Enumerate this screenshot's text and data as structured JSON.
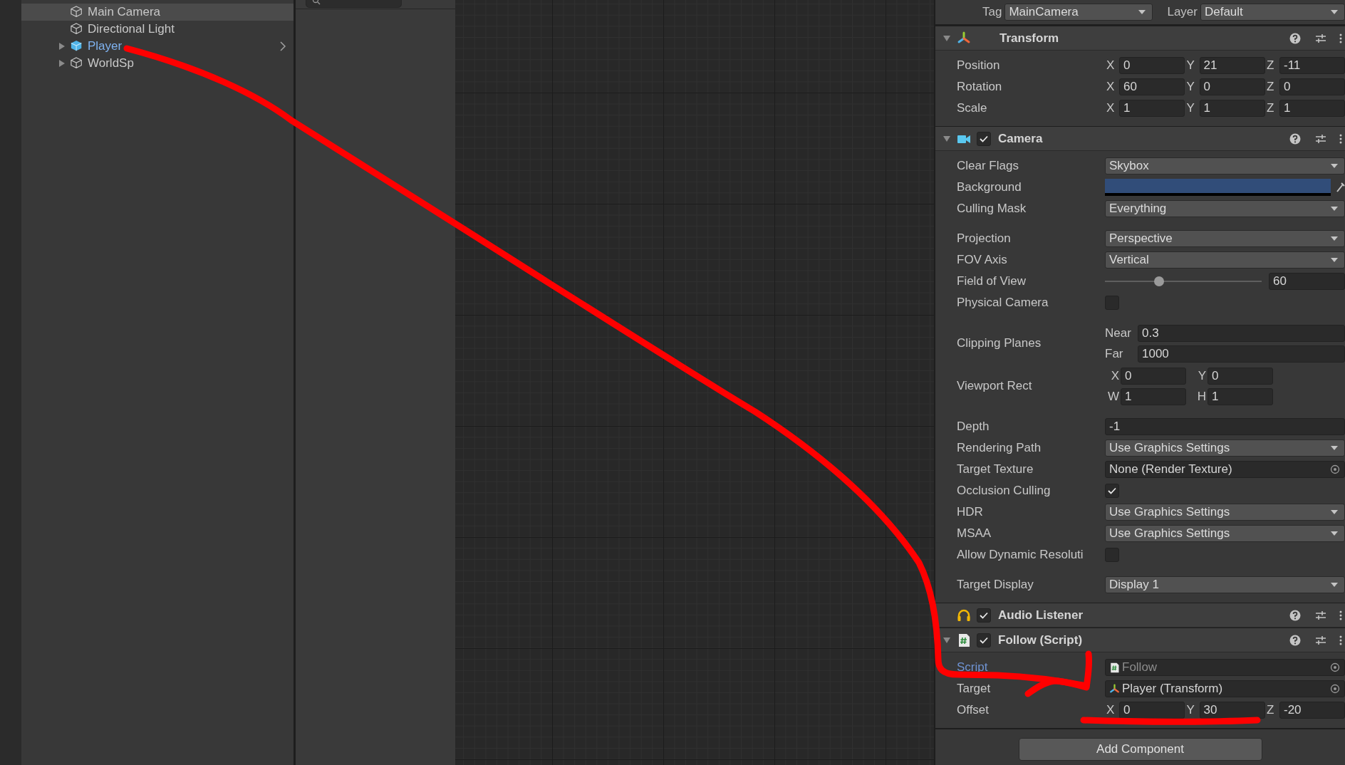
{
  "hierarchy": {
    "items": [
      {
        "label": "Main Camera",
        "kind": "gameobject",
        "selected": true,
        "expandable": false
      },
      {
        "label": "Directional Light",
        "kind": "gameobject",
        "selected": false,
        "expandable": false
      },
      {
        "label": "Player",
        "kind": "prefab",
        "selected": false,
        "expandable": true
      },
      {
        "label": "WorldSp",
        "kind": "gameobject",
        "selected": false,
        "expandable": true
      }
    ]
  },
  "inspector": {
    "tag": {
      "label": "Tag",
      "value": "MainCamera"
    },
    "layer": {
      "label": "Layer",
      "value": "Default"
    },
    "components": [
      {
        "title": "Transform",
        "kind": "transform",
        "expanded": true,
        "sections": [
          {
            "properties": [
              {
                "label": "Position",
                "kind": "vector",
                "values": [
                  {
                    "axis": "X",
                    "value": "0"
                  },
                  {
                    "axis": "Y",
                    "value": "21"
                  },
                  {
                    "axis": "Z",
                    "value": "-11"
                  }
                ]
              },
              {
                "label": "Rotation",
                "kind": "vector",
                "values": [
                  {
                    "axis": "X",
                    "value": "60"
                  },
                  {
                    "axis": "Y",
                    "value": "0"
                  },
                  {
                    "axis": "Z",
                    "value": "0"
                  }
                ]
              },
              {
                "label": "Scale",
                "kind": "vector",
                "values": [
                  {
                    "axis": "X",
                    "value": "1"
                  },
                  {
                    "axis": "Y",
                    "value": "1"
                  },
                  {
                    "axis": "Z",
                    "value": "1"
                  }
                ]
              }
            ]
          }
        ]
      },
      {
        "title": "Camera",
        "kind": "camera",
        "enabled": true,
        "expanded": true,
        "sections": [
          {
            "properties": [
              {
                "label": "Clear Flags",
                "kind": "dropdown",
                "value": "Skybox"
              },
              {
                "label": "Background",
                "kind": "color",
                "color": "#314d79"
              },
              {
                "label": "Culling Mask",
                "kind": "dropdown",
                "value": "Everything"
              }
            ]
          },
          {
            "properties": [
              {
                "label": "Projection",
                "kind": "dropdown",
                "value": "Perspective"
              },
              {
                "label": "FOV Axis",
                "kind": "dropdown",
                "value": "Vertical"
              },
              {
                "label": "Field of View",
                "kind": "slider",
                "level": 0.345,
                "value": "60"
              },
              {
                "label": "Physical Camera",
                "kind": "checkbox",
                "checked": false
              }
            ]
          },
          {
            "properties": [
              {
                "label": "Clipping Planes",
                "kind": "pairs",
                "values": [
                  {
                    "axis": "Near",
                    "value": "0.3"
                  },
                  {
                    "axis": "Far",
                    "value": "1000"
                  }
                ]
              },
              {
                "label": "Viewport Rect",
                "kind": "rect",
                "values": [
                  {
                    "axis": "X",
                    "value": "0"
                  },
                  {
                    "axis": "Y",
                    "value": "0"
                  },
                  {
                    "axis": "W",
                    "value": "1"
                  },
                  {
                    "axis": "H",
                    "value": "1"
                  }
                ]
              }
            ]
          },
          {
            "properties": [
              {
                "label": "Depth",
                "kind": "field",
                "value": "-1"
              },
              {
                "label": "Rendering Path",
                "kind": "dropdown",
                "value": "Use Graphics Settings"
              },
              {
                "label": "Target Texture",
                "kind": "object",
                "value": "None (Render Texture)"
              },
              {
                "label": "Occlusion Culling",
                "kind": "checkbox",
                "checked": true
              },
              {
                "label": "HDR",
                "kind": "dropdown",
                "value": "Use Graphics Settings"
              },
              {
                "label": "MSAA",
                "kind": "dropdown",
                "value": "Use Graphics Settings"
              },
              {
                "label": "Allow Dynamic Resoluti",
                "kind": "checkbox",
                "checked": false
              }
            ]
          },
          {
            "properties": [
              {
                "label": "Target Display",
                "kind": "dropdown",
                "value": "Display 1"
              }
            ]
          }
        ]
      },
      {
        "title": "Audio Listener",
        "kind": "audio",
        "enabled": true,
        "expanded": false
      },
      {
        "title": "Follow (Script)",
        "kind": "script",
        "enabled": true,
        "expanded": true,
        "sections": [
          {
            "properties": [
              {
                "label": "Script",
                "kind": "script",
                "value": "Follow"
              },
              {
                "label": "Target",
                "kind": "transform_ref",
                "value": "Player (Transform)"
              },
              {
                "label": "Offset",
                "kind": "vector",
                "values": [
                  {
                    "axis": "X",
                    "value": "0"
                  },
                  {
                    "axis": "Y",
                    "value": "30"
                  },
                  {
                    "axis": "Z",
                    "value": "-20"
                  }
                ]
              }
            ]
          }
        ]
      }
    ],
    "add_button": "Add Component"
  }
}
